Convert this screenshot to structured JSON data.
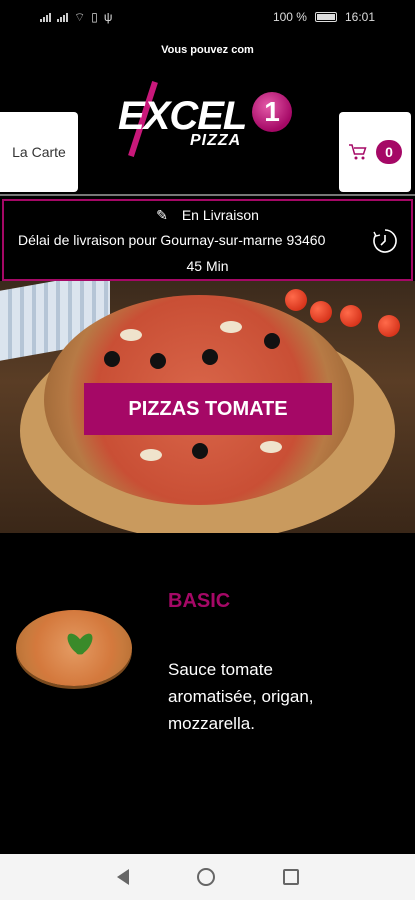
{
  "status_bar": {
    "battery_percent": "100 %",
    "time": "16:01"
  },
  "ticker": {
    "text": "Vous pouvez com"
  },
  "header": {
    "carte_button": "La Carte",
    "cart_count": "0",
    "logo_main": "EXCEL",
    "logo_digit": "1",
    "logo_sub": "PIZZA"
  },
  "delivery": {
    "mode": "En Livraison",
    "info": "Délai de livraison pour Gournay-sur-marne 93460",
    "duration": "45 Min"
  },
  "hero": {
    "category_button": "PIZZAS TOMATE"
  },
  "product": {
    "title": "BASIC",
    "description": "Sauce tomate aromatisée, origan, mozzarella."
  },
  "colors": {
    "accent": "#a50866",
    "background": "#000000"
  }
}
